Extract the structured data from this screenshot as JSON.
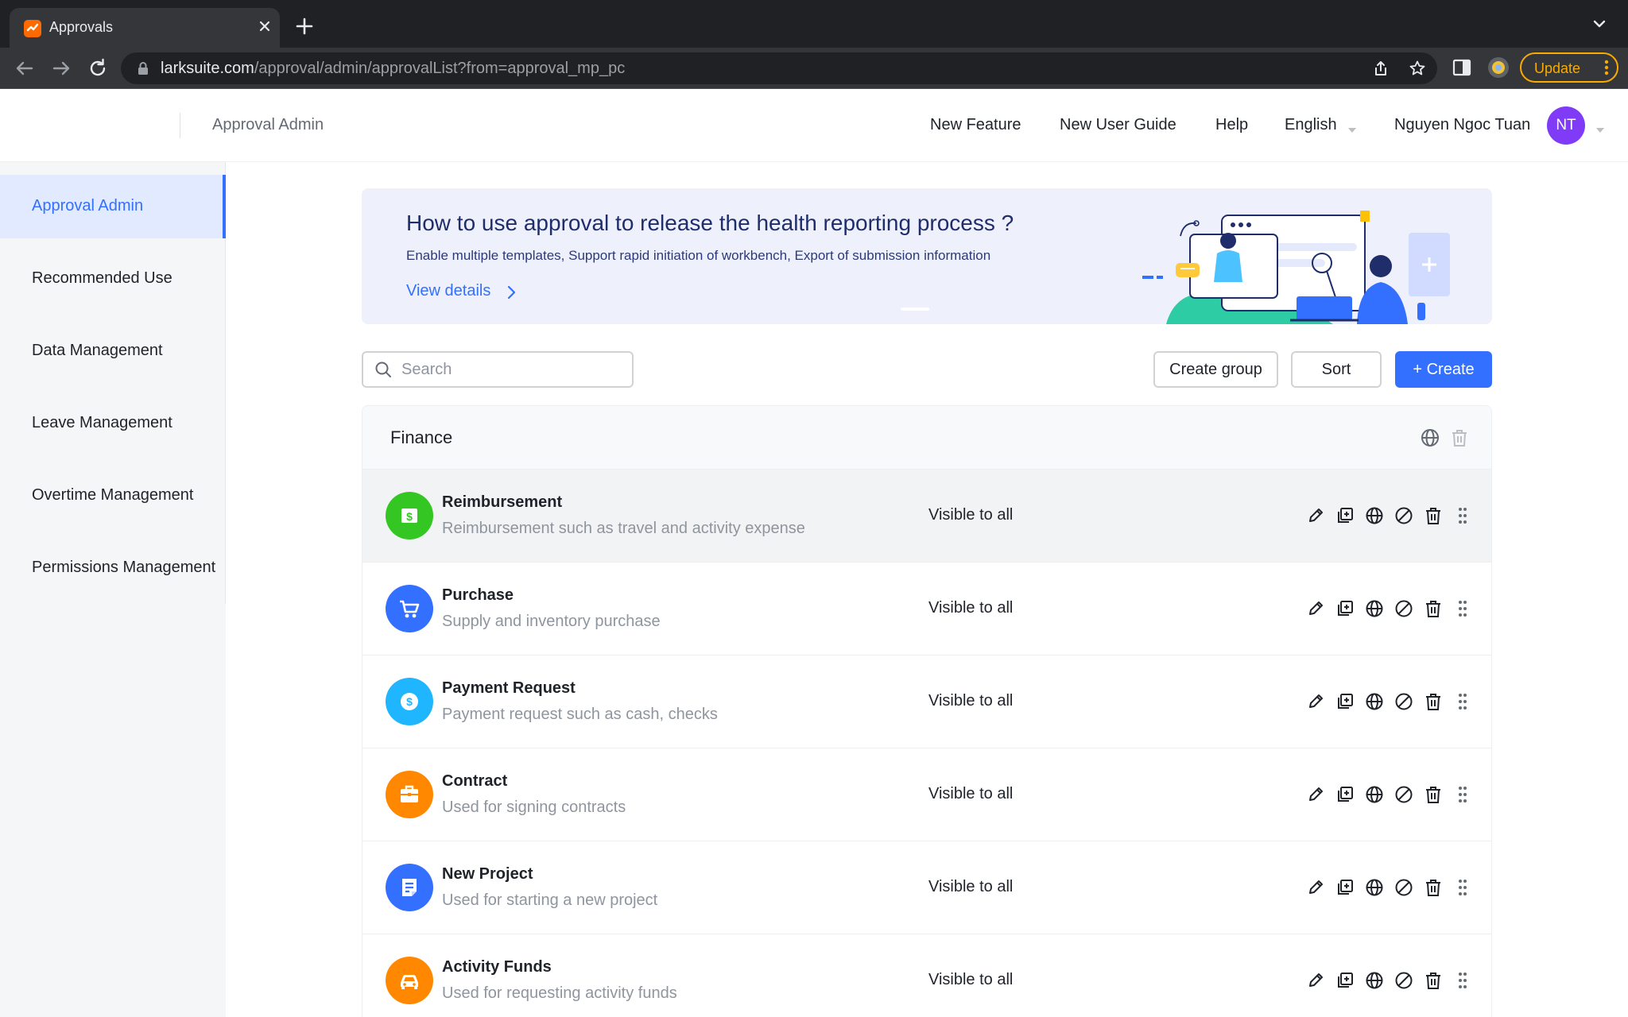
{
  "browser": {
    "tab_title": "Approvals",
    "url_host": "larksuite.com",
    "url_path": "/approval/admin/approvalList?from=approval_mp_pc",
    "update_label": "Update"
  },
  "header": {
    "title": "Approval Admin",
    "links": [
      "New Feature",
      "New User Guide",
      "Help"
    ],
    "language": "English",
    "user_name": "Nguyen Ngoc Tuan",
    "avatar_initials": "NT",
    "avatar_color": "#7f3bf5"
  },
  "sidebar": {
    "items": [
      {
        "label": "Approval Admin",
        "active": true
      },
      {
        "label": "Recommended Use",
        "active": false
      },
      {
        "label": "Data Management",
        "active": false
      },
      {
        "label": "Leave Management",
        "active": false
      },
      {
        "label": "Overtime Management",
        "active": false
      },
      {
        "label": "Permissions Management",
        "active": false
      }
    ]
  },
  "banner": {
    "title": "How to use approval to release the health reporting process ?",
    "subtitle": "Enable multiple templates,  Support rapid initiation of workbench,  Export of submission information",
    "link": "View details"
  },
  "toolbar": {
    "search_placeholder": "Search",
    "create_group": "Create group",
    "sort": "Sort",
    "create": "+ Create"
  },
  "group": {
    "title": "Finance",
    "rows": [
      {
        "name": "Reimbursement",
        "description": "Reimbursement such as travel and activity expense",
        "visibility": "Visible to all",
        "icon": "dollar-bill-icon",
        "color": "#34c724"
      },
      {
        "name": "Purchase",
        "description": "Supply and inventory purchase",
        "visibility": "Visible to all",
        "icon": "cart-icon",
        "color": "#3370ff"
      },
      {
        "name": "Payment Request",
        "description": "Payment request such as cash, checks",
        "visibility": "Visible to all",
        "icon": "dollar-coin-icon",
        "color": "#1fb6ff"
      },
      {
        "name": "Contract",
        "description": "Used for signing contracts",
        "visibility": "Visible to all",
        "icon": "briefcase-icon",
        "color": "#ff8800"
      },
      {
        "name": "New Project",
        "description": "Used for starting a new project",
        "visibility": "Visible to all",
        "icon": "document-icon",
        "color": "#3370ff"
      },
      {
        "name": "Activity Funds",
        "description": "Used for requesting activity funds",
        "visibility": "Visible to all",
        "icon": "car-icon",
        "color": "#ff8800"
      }
    ]
  },
  "colors": {
    "primary": "#3370ff",
    "sidebar_active_bg": "#e1eaff",
    "chrome_dark": "#202124",
    "update_accent": "#f9ab00"
  }
}
